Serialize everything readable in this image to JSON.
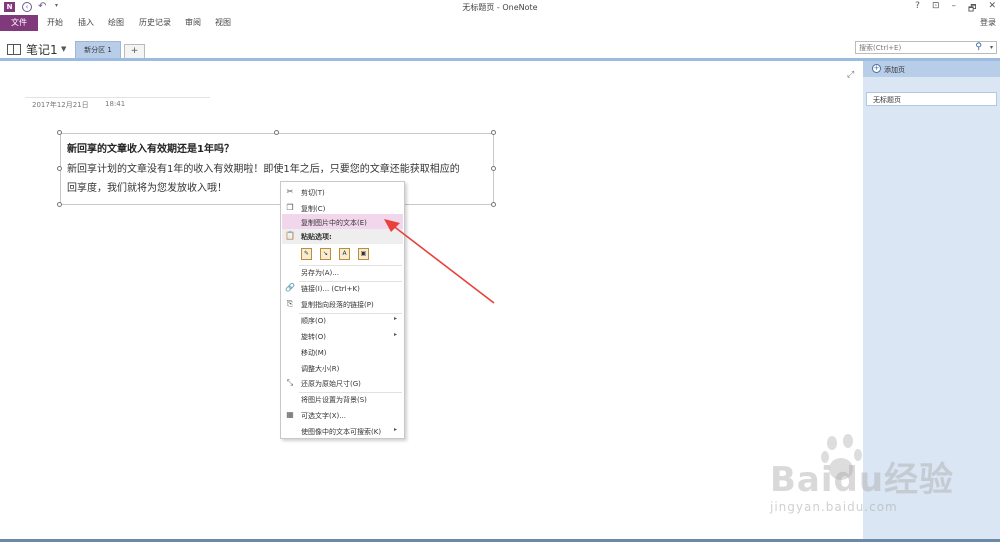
{
  "window": {
    "title": "无标题页 - OneNote",
    "app_icon": "N",
    "controls": [
      "?",
      "⊡",
      "–",
      "🗗",
      "✕"
    ]
  },
  "ribbon": {
    "file_tab": "文件",
    "tabs": [
      "开始",
      "插入",
      "绘图",
      "历史记录",
      "审阅",
      "视图"
    ],
    "signin": "登录"
  },
  "notebook": {
    "name": "笔记1",
    "section_tab": "新分区 1",
    "add_section": "+"
  },
  "search": {
    "placeholder": "搜索(Ctrl+E)"
  },
  "page": {
    "date": "2017年12月21日",
    "time": "18:41"
  },
  "picture": {
    "title": "新回享的文章收入有效期还是1年吗？",
    "body_line1": "新回享计划的文章没有1年的收入有效期啦！即使1年之后，只要您的文章还能获取相应的",
    "body_line2": "回享度，我们就将为您发放收入哦！"
  },
  "context_menu": {
    "cut": "剪切(T)",
    "copy": "复制(C)",
    "copy_text_from_picture": "复制图片中的文本(E)",
    "paste_options": "粘贴选项:",
    "save_as": "另存为(A)...",
    "link": "链接(I)...  (Ctrl+K)",
    "copy_paragraph_link": "复制指向段落的链接(P)",
    "order": "顺序(O)",
    "rotate": "旋转(O)",
    "move": "移动(M)",
    "resize": "调整大小(R)",
    "restore_size": "还原为原始尺寸(G)",
    "set_background": "将图片设置为背景(S)",
    "alt_text": "可选文字(X)...",
    "make_searchable": "使图像中的文本可搜索(K)"
  },
  "sidebar": {
    "add_page": "添加页",
    "page_item": "无标题页"
  },
  "watermark": {
    "brand": "Baidu经验",
    "url": "jingyan.baidu.com"
  },
  "colors": {
    "onenote_purple": "#80397b",
    "highlight": "#f2d7ec",
    "sidebar": "#dae6f4",
    "arrow": "#e8413c"
  }
}
